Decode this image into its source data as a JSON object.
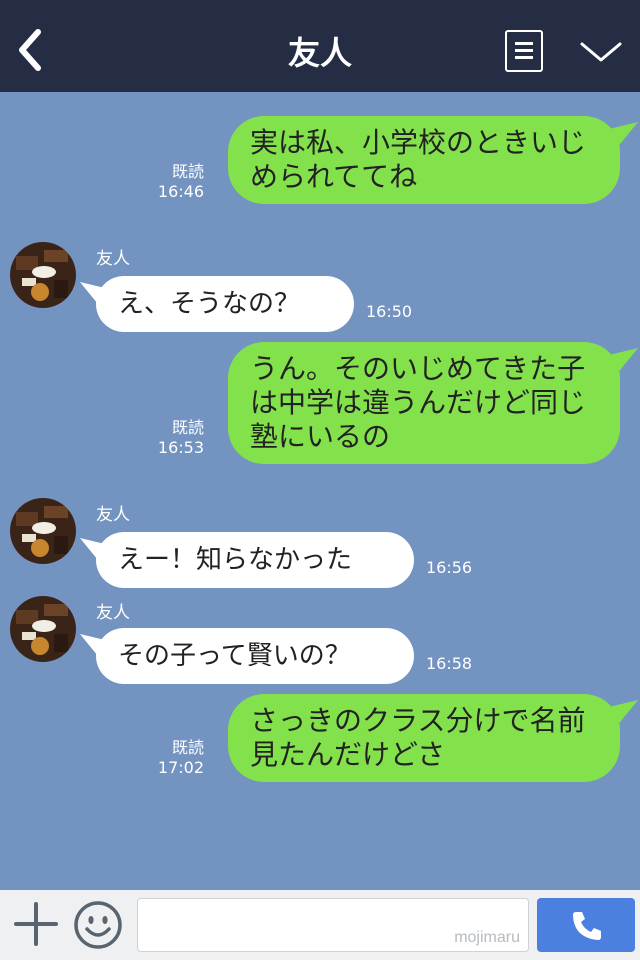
{
  "header": {
    "title": "友人"
  },
  "messages": [
    {
      "id": "m1",
      "direction": "out",
      "text": "実は私、小学校のときいじめられててね",
      "read": "既読",
      "time": "16:46"
    },
    {
      "id": "m2",
      "direction": "in",
      "sender": "友人",
      "text": "え、そうなの？",
      "time": "16:50"
    },
    {
      "id": "m3",
      "direction": "out",
      "text": "うん。そのいじめてきた子は中学は違うんだけど同じ塾にいるの",
      "read": "既読",
      "time": "16:53"
    },
    {
      "id": "m4",
      "direction": "in",
      "sender": "友人",
      "text": "えー！知らなかった",
      "time": "16:56"
    },
    {
      "id": "m5",
      "direction": "in",
      "sender": "友人",
      "text": "その子って賢いの？",
      "time": "16:58"
    },
    {
      "id": "m6",
      "direction": "out",
      "text": "さっきのクラス分けで名前見たんだけどさ",
      "read": "既読",
      "time": "17:02"
    }
  ],
  "footer": {
    "watermark": "mojimaru"
  },
  "colors": {
    "header_bg": "#252d44",
    "chat_bg": "#7393c1",
    "out_bubble": "#83e14b",
    "in_bubble": "#ffffff",
    "call_button": "#4b80e0"
  },
  "icons": [
    "back-icon",
    "menu-icon",
    "chevron-down-icon",
    "plus-icon",
    "smiley-icon",
    "phone-icon"
  ]
}
